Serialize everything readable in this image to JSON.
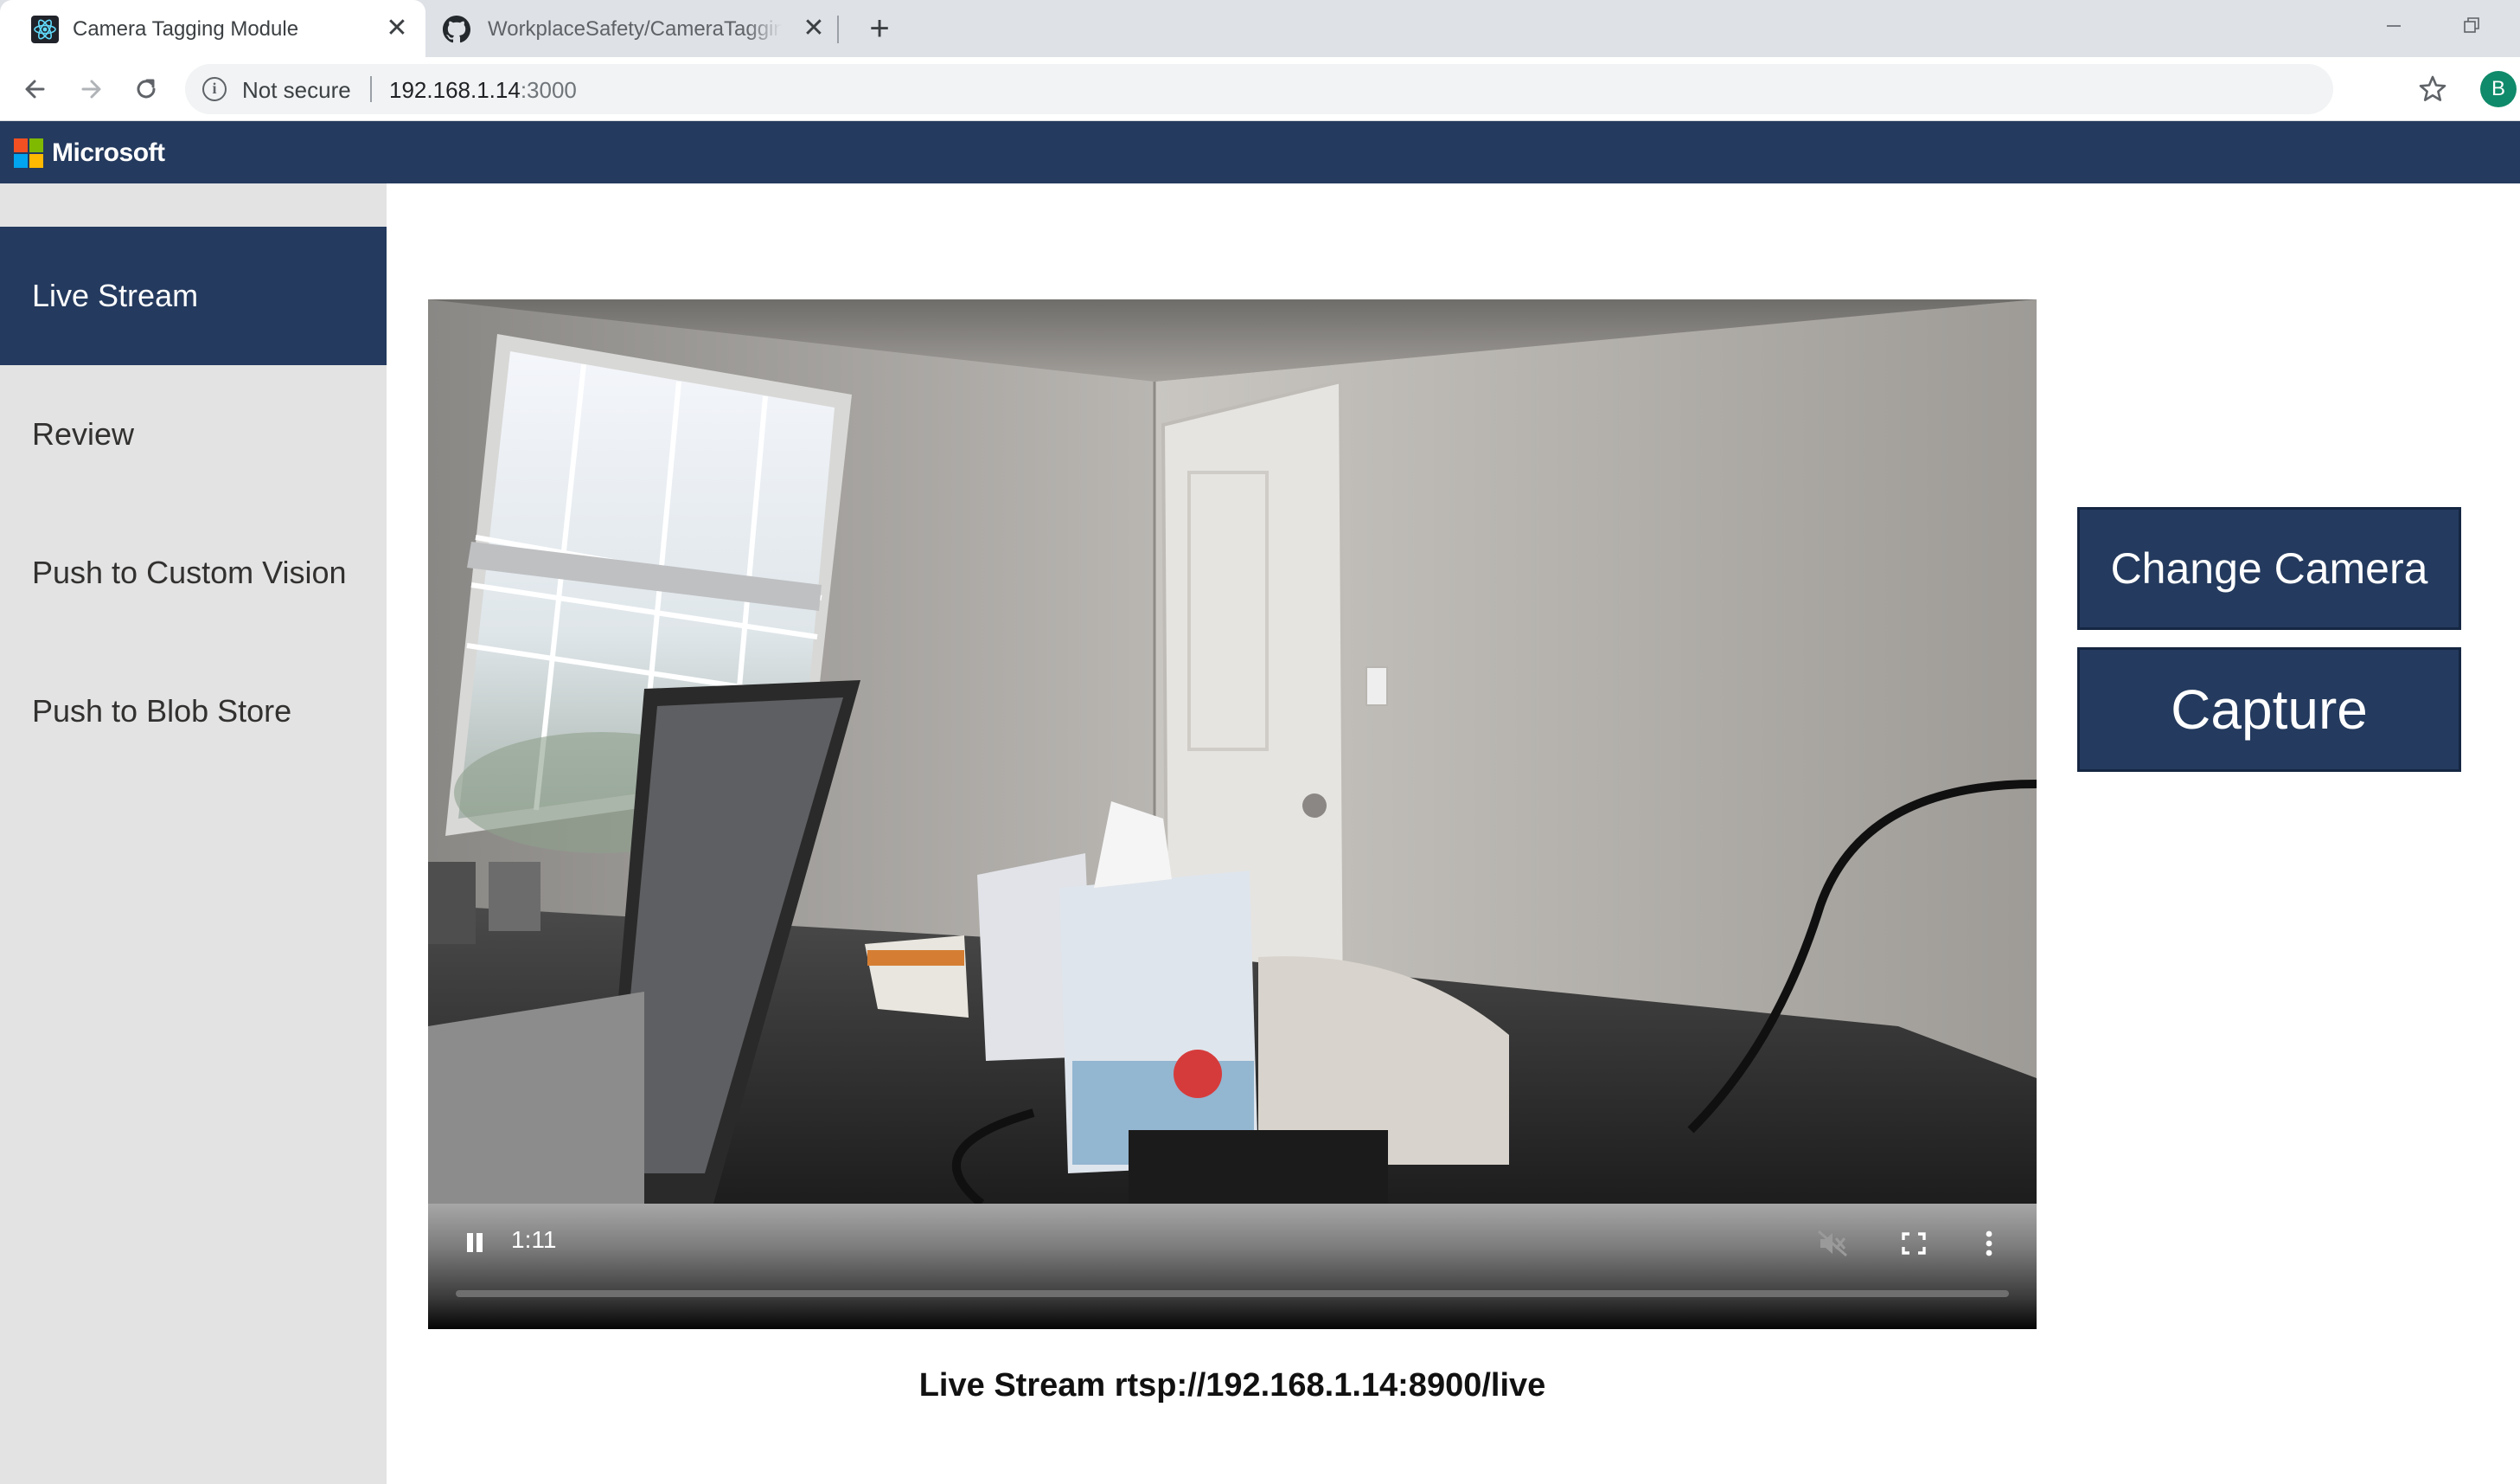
{
  "browser": {
    "tabs": [
      {
        "title": "Camera Tagging Module",
        "favicon": "react-icon",
        "active": true
      },
      {
        "title": "WorkplaceSafety/CameraTagging",
        "favicon": "github-icon",
        "active": false
      }
    ],
    "close_glyph": "✕",
    "new_tab_glyph": "+",
    "address": {
      "security_label": "Not secure",
      "host": "192.168.1.14",
      "port": ":3000"
    },
    "profile_initial": "B"
  },
  "header": {
    "brand": "Microsoft",
    "logo_colors": [
      "#f25022",
      "#7fba00",
      "#00a4ef",
      "#ffb900"
    ],
    "background": "#243a5e"
  },
  "sidebar": {
    "items": [
      {
        "label": "Live Stream",
        "active": true
      },
      {
        "label": "Review",
        "active": false
      },
      {
        "label": "Push to Custom Vision",
        "active": false
      },
      {
        "label": "Push to Blob Store",
        "active": false
      }
    ]
  },
  "player": {
    "time": "1:11",
    "progress_fraction": 0.0,
    "muted": true
  },
  "actions": {
    "change_camera": "Change Camera",
    "capture": "Capture"
  },
  "stream_label": "Live Stream rtsp://192.168.1.14:8900/live"
}
